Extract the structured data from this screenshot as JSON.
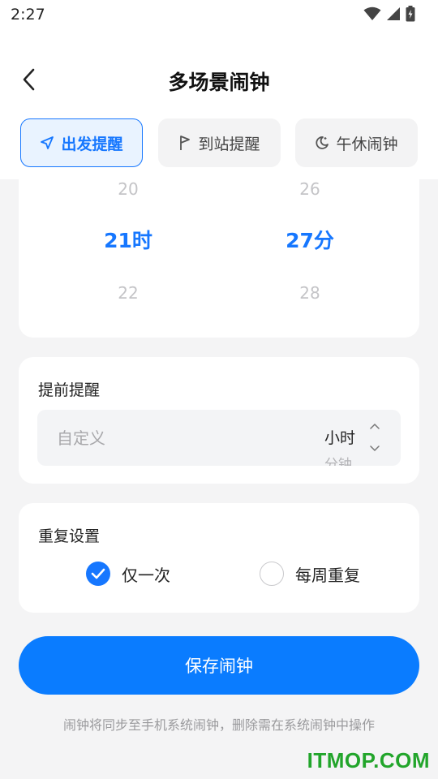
{
  "status": {
    "time": "2:27"
  },
  "header": {
    "title": "多场景闹钟"
  },
  "tabs": [
    {
      "label": "出发提醒",
      "icon": "navigation-arrow-icon",
      "active": true
    },
    {
      "label": "到站提醒",
      "icon": "flag-icon",
      "active": false
    },
    {
      "label": "午休闹钟",
      "icon": "moon-icon",
      "active": false
    }
  ],
  "picker": {
    "hour": {
      "prev": "20",
      "selected": "21时",
      "next": "22"
    },
    "minute": {
      "prev": "26",
      "selected": "27分",
      "next": "28"
    }
  },
  "advance": {
    "title": "提前提醒",
    "placeholder": "自定义",
    "unit_selected": "小时",
    "unit_next": "分钟"
  },
  "repeat": {
    "title": "重复设置",
    "options": [
      {
        "label": "仅一次",
        "checked": true
      },
      {
        "label": "每周重复",
        "checked": false
      }
    ]
  },
  "save_label": "保存闹钟",
  "footer_note": "闹钟将同步至手机系统闹钟，删除需在系统闹钟中操作",
  "watermark": "ITMOP.COM",
  "colors": {
    "accent": "#1677ff",
    "button": "#0a7cff",
    "watermark": "#22a52b"
  }
}
